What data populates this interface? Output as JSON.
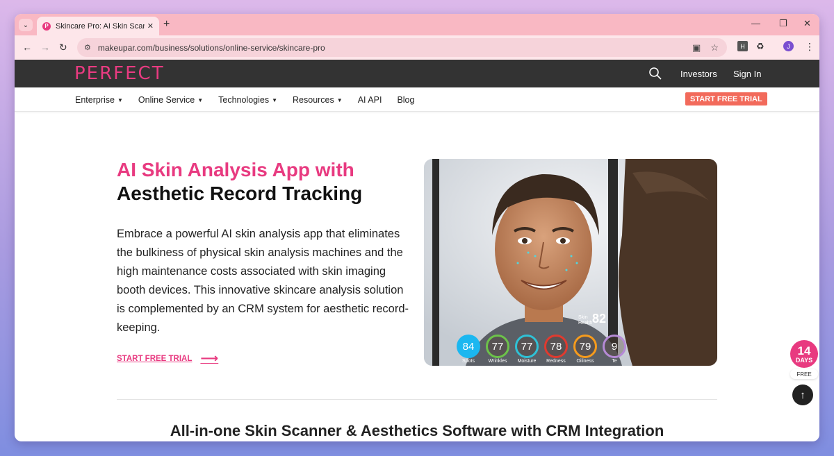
{
  "browser": {
    "tab_title": "Skincare Pro: AI Skin Scanner",
    "favicon_letter": "P",
    "url": "makeupar.com/business/solutions/online-service/skincare-pro",
    "profile_initial": "J",
    "ext_badge": "H"
  },
  "header": {
    "logo": "PERFECT",
    "links": [
      "Investors",
      "Sign In"
    ]
  },
  "subnav": {
    "items": [
      "Enterprise",
      "Online Service",
      "Technologies",
      "Resources",
      "AI API",
      "Blog"
    ],
    "trial_label": "START FREE TRIAL"
  },
  "hero": {
    "title_pink": "AI Skin Analysis App with",
    "title_dark": "Aesthetic Record Tracking",
    "description": "Embrace a powerful AI skin analysis app that eliminates the bulkiness of physical skin analysis machines and the high maintenance costs associated with skin imaging booth devices. This innovative skincare analysis solution is complemented by an CRM system for aesthetic record-keeping.",
    "cta_label": "START FREE TRIAL"
  },
  "scan": {
    "health_label": "Skin Health",
    "health_score": "82",
    "metrics": [
      {
        "value": "84",
        "label": "Spots",
        "color": "#1bb7f0"
      },
      {
        "value": "77",
        "label": "Wrinkles",
        "color": "#6cc24a"
      },
      {
        "value": "77",
        "label": "Moisture",
        "color": "#2fc1d6"
      },
      {
        "value": "78",
        "label": "Redness",
        "color": "#e03a2f"
      },
      {
        "value": "79",
        "label": "Oiliness",
        "color": "#f59b1d"
      },
      {
        "value": "9",
        "label": "Te",
        "color": "#b58ad6"
      }
    ]
  },
  "section": {
    "title": "All-in-one Skin Scanner & Aesthetics Software with CRM Integration"
  },
  "widgets": {
    "days_number": "14",
    "days_label": "DAYS",
    "free_label": "FREE"
  },
  "colors": {
    "brand_pink": "#e83a80",
    "trial_orange": "#f26a5b",
    "header_dark": "#333333"
  }
}
